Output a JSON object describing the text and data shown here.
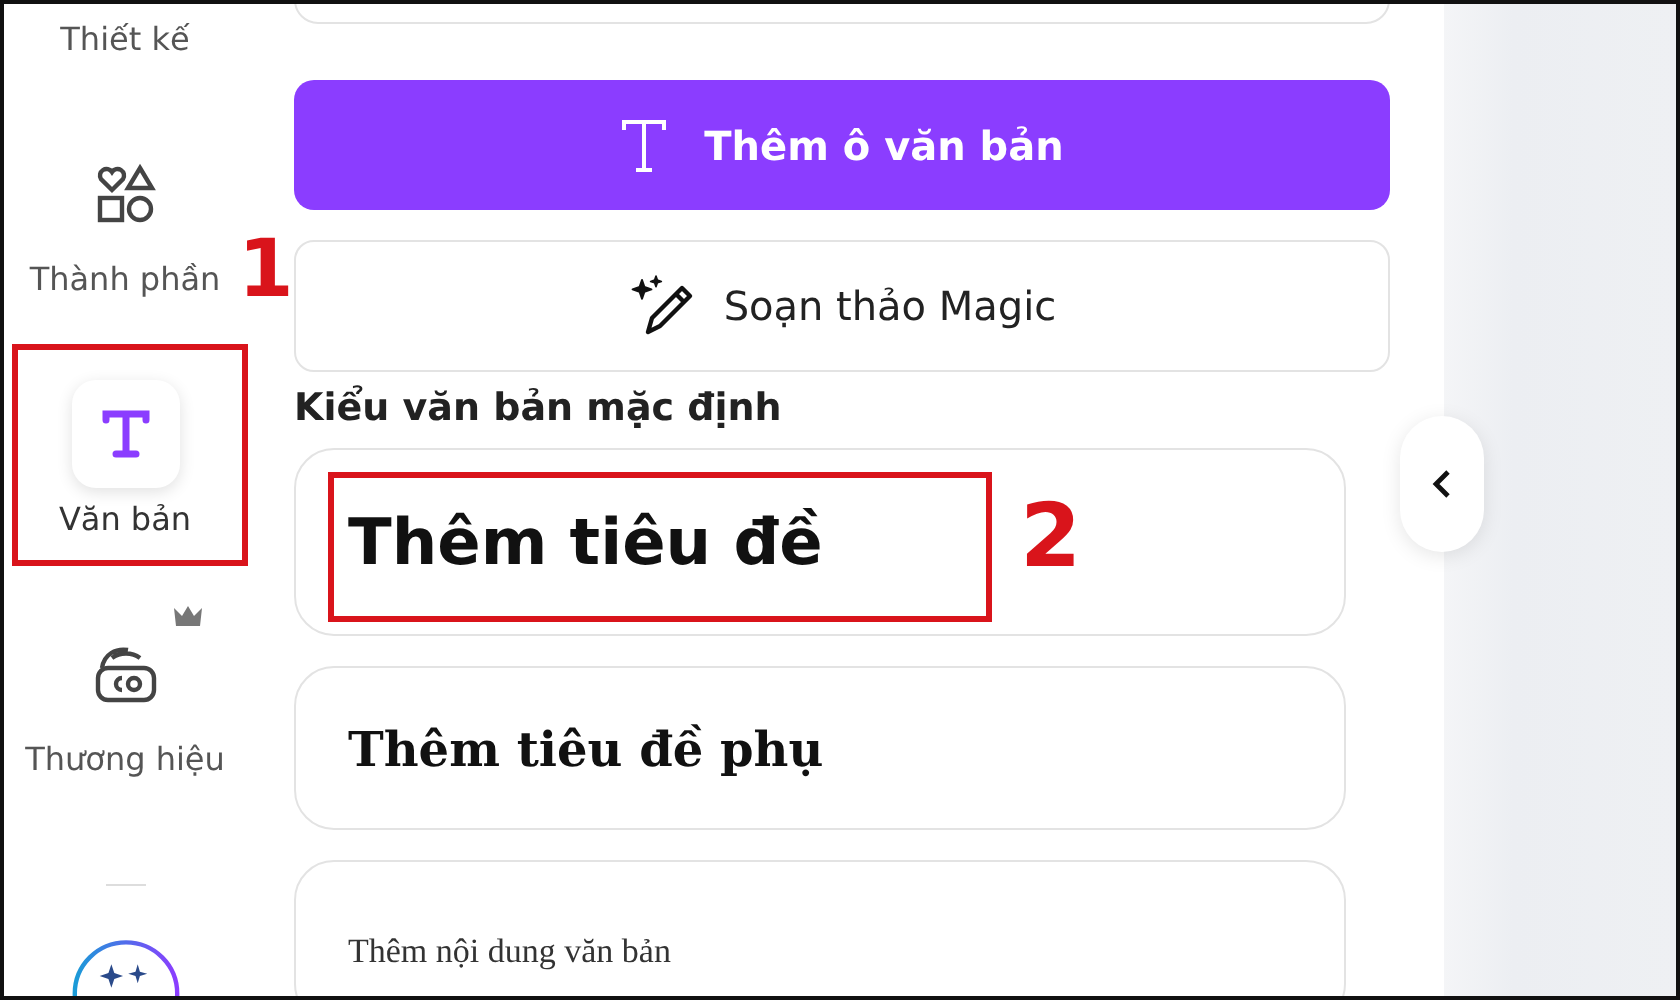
{
  "sidebar": {
    "items": [
      {
        "label": "Thiết kế",
        "selected": false
      },
      {
        "label": "Thành phần",
        "selected": false
      },
      {
        "label": "Văn bản",
        "selected": true,
        "callout": "1"
      },
      {
        "label": "Thương hiệu",
        "selected": false,
        "premium": true
      }
    ]
  },
  "panel": {
    "add_text_button": "Thêm ô văn bản",
    "magic_button": "Soạn thảo Magic",
    "section_title": "Kiểu văn bản mặc định",
    "text_styles": [
      {
        "label": "Thêm tiêu đề",
        "kind": "heading",
        "callout": "2"
      },
      {
        "label": "Thêm tiêu đề phụ",
        "kind": "subheading"
      },
      {
        "label": "Thêm nội dung văn bản",
        "kind": "body"
      }
    ]
  }
}
